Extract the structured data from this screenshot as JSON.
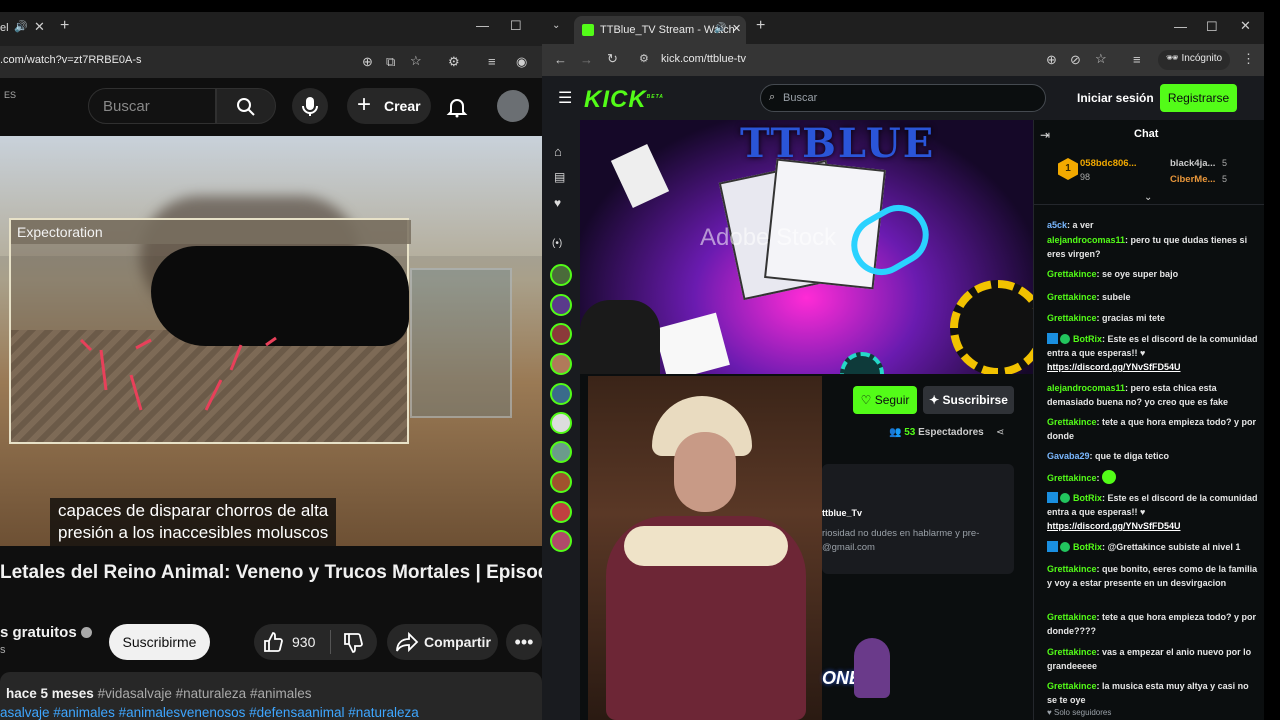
{
  "left_window": {
    "tab_partial": "el",
    "url": ".com/watch?v=zt7RRBE0A-s",
    "yt_region": "ES",
    "search_placeholder": "Buscar",
    "create_label": "Crear",
    "video": {
      "overlay_label": "Expectoration",
      "subtitle_line1": "capaces de disparar chorros de alta",
      "subtitle_line2": "presión a los inaccesibles moluscos"
    },
    "title": "Letales del Reino Animal: Veneno y Trucos Mortales | Episodio",
    "channel_name": "s gratuitos",
    "channel_subs": "s",
    "subscribe_label": "Suscribirme",
    "likes": "930",
    "share_label": "Compartir",
    "desc_meta": "hace 5 meses",
    "desc_tags_top": "#vidasalvaje #naturaleza #animales",
    "desc_tags_bottom": "asalvaje #animales #animalesvenenosos #defensaanimal #naturaleza"
  },
  "right_window": {
    "tab_title": "TTBlue_TV Stream - Watch",
    "url": "kick.com/ttblue-tv",
    "incognito_label": "Incógnito",
    "kick_logo": "KICK",
    "kick_beta": "BETA",
    "search_placeholder": "Buscar",
    "login_label": "Iniciar sesión",
    "register_label": "Registrarse",
    "stream_banner_text": "TTBLUE",
    "watermark": "Adobe Stock",
    "follow_label": "Seguir",
    "subscribe_label": "Suscribirse",
    "viewers_count": "53",
    "viewers_label": "Espectadores",
    "about_name": "ttblue_Tv",
    "about_text_1": "riosidad no dudes en hablarme y pre-",
    "about_text_2": "@gmail.com",
    "promo_text": "ONES",
    "chat": {
      "title": "Chat",
      "leader_1_name": "058bdc806...",
      "leader_1_count": "98",
      "leader_rank": "1",
      "leader_2_name": "black4ja...",
      "leader_2_count": "5",
      "leader_3_name": "CiberMe...",
      "leader_3_count": "5",
      "footer": "Solo seguidores",
      "messages": [
        {
          "user": "a5ck",
          "text": "a ver",
          "user_color": "#7ab8ff"
        },
        {
          "user": "alejandrocomas11",
          "text": "pero tu que dudas tienes si eres virgen?",
          "user_color": "#53fc18"
        },
        {
          "user": "Grettakince",
          "text": "se oye super bajo",
          "user_color": "#53fc18"
        },
        {
          "user": "Grettakince",
          "text": "subele",
          "user_color": "#53fc18"
        },
        {
          "user": "Grettakince",
          "text": "gracias mi tete",
          "user_color": "#53fc18"
        },
        {
          "user": "BotRix",
          "text": "Este es el discord de la comunidad entra a que esperas!! ♥",
          "link": "https://discord.gg/YNvSfFD54U",
          "user_color": "#53fc18"
        },
        {
          "user": "alejandrocomas11",
          "text": "pero esta chica esta demasiado buena no? yo creo que es fake",
          "user_color": "#53fc18"
        },
        {
          "user": "Grettakince",
          "text": "tete a que hora empieza todo? y por donde",
          "user_color": "#53fc18"
        },
        {
          "user": "Gavaba29",
          "text": "que te diga tetico",
          "user_color": "#7ab8ff"
        },
        {
          "user": "Grettakince",
          "text": "",
          "user_color": "#53fc18"
        },
        {
          "user": "BotRix",
          "text": "Este es el discord de la comunidad entra a que esperas!! ♥",
          "link": "https://discord.gg/YNvSfFD54U",
          "user_color": "#53fc18"
        },
        {
          "user": "BotRix",
          "text": "@Grettakince subiste al nivel 1",
          "user_color": "#53fc18"
        },
        {
          "user": "Grettakince",
          "text": "que bonito, eeres como de la familia y voy a estar presente en un desvirgacion",
          "user_color": "#53fc18"
        },
        {
          "user": "Grettakince",
          "text": "tete a que hora empieza todo? y por donde????",
          "user_color": "#53fc18"
        },
        {
          "user": "Grettakince",
          "text": "vas a empezar el anio nuevo por lo grandeeeee",
          "user_color": "#53fc18"
        },
        {
          "user": "Grettakince",
          "text": "la musica esta muy altya y casi no se te oye",
          "user_color": "#53fc18"
        }
      ]
    }
  },
  "colors": {
    "kick_green": "#53fc18",
    "yt_link": "#3ea6ff"
  },
  "icons": [
    "search-icon",
    "mic-icon",
    "bell-icon",
    "plus-icon",
    "like-icon",
    "dislike-icon",
    "share-icon",
    "more-icon",
    "home-icon",
    "heart-icon",
    "menu-icon",
    "viewers-icon"
  ]
}
